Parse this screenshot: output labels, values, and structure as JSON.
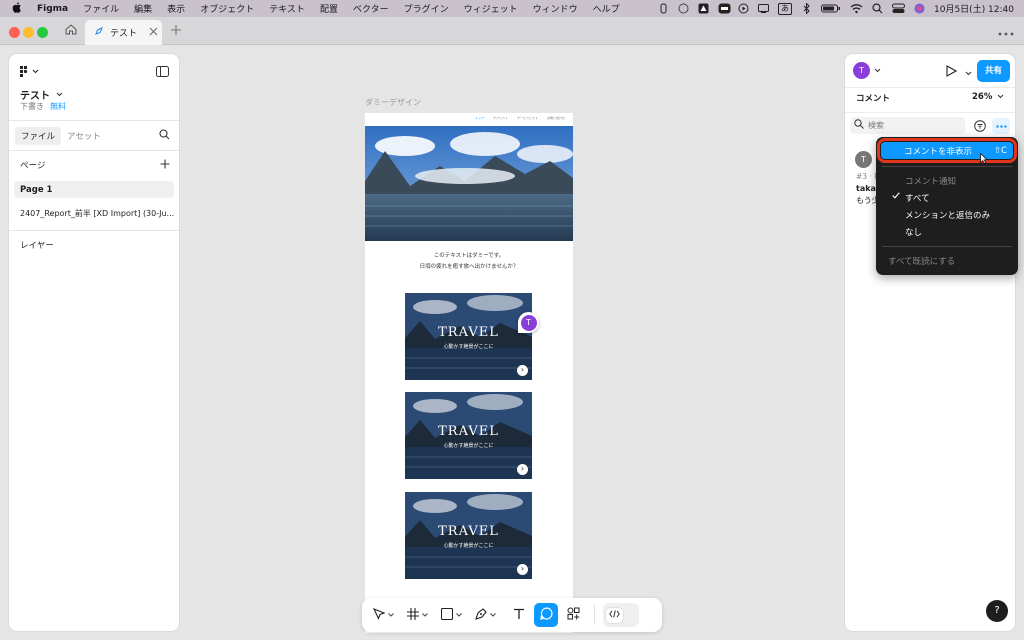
{
  "menubar": {
    "app": "Figma",
    "items": [
      "ファイル",
      "編集",
      "表示",
      "オブジェクト",
      "テキスト",
      "配置",
      "ベクター",
      "プラグイン",
      "ウィジェット",
      "ウィンドウ",
      "ヘルプ"
    ],
    "ime": "あ",
    "datetime": "10月5日(土) 12:40"
  },
  "tabs": {
    "active_label": "テスト"
  },
  "left_panel": {
    "file_name": "テスト",
    "draft_label": "下書き",
    "plan_label": "無料",
    "tab_file": "ファイル",
    "tab_assets": "アセット",
    "pages_header": "ページ",
    "pages": [
      "Page 1",
      "2407_Report_前半 [XD Import] (30-Ju..."
    ],
    "layers_header": "レイヤー"
  },
  "canvas": {
    "frame_label": "ダミーデザイン",
    "nav_items": [
      "トップ",
      "サブリスト",
      "サービスリスト",
      "お問い合わせ"
    ],
    "body_text_1": "このテキストはダミーです。",
    "body_text_2": "日頃の疲れを癒す旅へ出かけませんか？",
    "card_title": "TRAVEL",
    "card_subtitle": "心動かす絶景がここに",
    "card_arrow": "›",
    "comment_pin": "T"
  },
  "right_panel": {
    "avatar": "T",
    "share_label": "共有",
    "section_label": "コメント",
    "zoom": "26%",
    "search_placeholder": "検索",
    "comment_avatar": "T",
    "comment_meta": "#3 · P",
    "comment_author": "takat",
    "comment_text": "もう少"
  },
  "dropdown": {
    "hide_comments": "コメントを非表示",
    "hide_shortcut": "⇧C",
    "notify_header": "コメント通知",
    "opt_all": "すべて",
    "opt_mentions": "メンションと返信のみ",
    "opt_none": "なし",
    "mark_all_read": "すべて既読にする"
  },
  "help_label": "?",
  "colors": {
    "accent": "#0d99ff",
    "highlight_border": "#e2361c",
    "avatar": "#8b3ddb"
  }
}
